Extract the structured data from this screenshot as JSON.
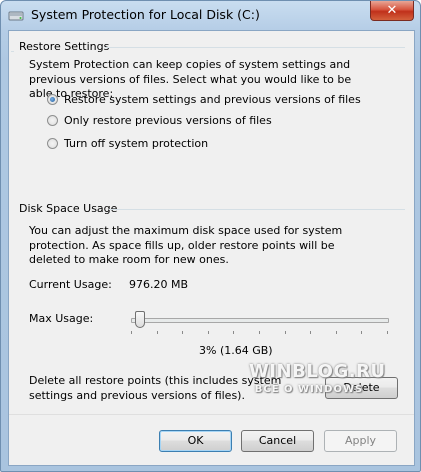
{
  "window": {
    "title": "System Protection for Local Disk (C:)"
  },
  "restore_settings": {
    "heading": "Restore Settings",
    "description": "System Protection can keep copies of system settings and previous versions of files. Select what you would like to be able to restore:",
    "options": [
      {
        "label": "Restore system settings and previous versions of files",
        "checked": true
      },
      {
        "label": "Only restore previous versions of files",
        "checked": false
      },
      {
        "label": "Turn off system protection",
        "checked": false
      }
    ]
  },
  "disk_space": {
    "heading": "Disk Space Usage",
    "description": "You can adjust the maximum disk space used for system protection. As space fills up, older restore points will be deleted to make room for new ones.",
    "current_usage_label": "Current Usage:",
    "current_usage_value": "976.20 MB",
    "max_usage_label": "Max Usage:",
    "max_usage_percent": 3,
    "max_usage_text": "3% (1.64 GB)",
    "delete_text": "Delete all restore points (this includes system settings and previous versions of files).",
    "delete_button": "Delete"
  },
  "footer": {
    "ok": "OK",
    "cancel": "Cancel",
    "apply": "Apply"
  },
  "watermark": {
    "line1": "WINBLOG.RU",
    "line2": "ВСЁ О WINDOWS"
  }
}
